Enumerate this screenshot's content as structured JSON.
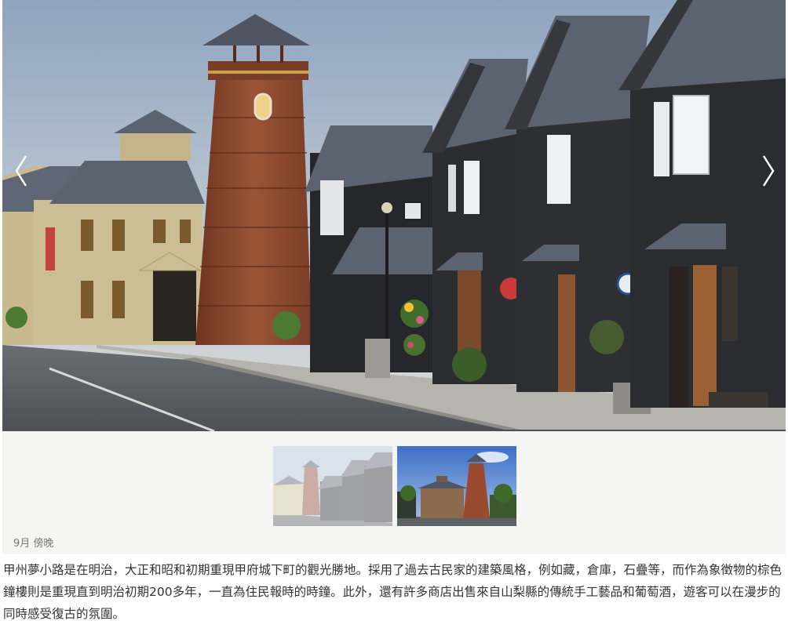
{
  "gallery": {
    "prev_label": "‹",
    "next_label": "›",
    "caption": "9月 傍晚",
    "thumbnails": [
      {
        "alt": "thumbnail-street-view",
        "active": false
      },
      {
        "alt": "thumbnail-clock-tower",
        "active": true
      }
    ]
  },
  "description": "甲州夢小路是在明治，大正和昭和初期重現甲府城下町的觀光勝地。採用了過去古民家的建築風格，例如藏，倉庫，石疊等，而作為象徵物的棕色鐘樓則是重現直到明治初期200多年，一直為住民報時的時鐘。此外，還有許多商店出售來自山梨縣的傳統手工藝品和葡萄酒，遊客可以在漫步的同時感受復古的氛圍。",
  "colors": {
    "sky": "#b9c6d6",
    "tower": "#8c4a33",
    "warehouse": "#2c2d31",
    "roof": "#5b6270",
    "road": "#5a5d63",
    "sidewalk": "#b5b4ae"
  },
  "icons": {
    "prev": "chevron-left-icon",
    "next": "chevron-right-icon"
  }
}
